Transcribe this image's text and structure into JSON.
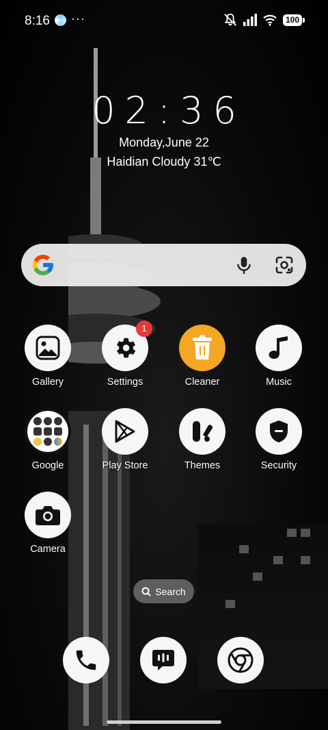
{
  "status_bar": {
    "time": "8:16",
    "more": "···",
    "battery": "100"
  },
  "widget": {
    "clock": "02:36",
    "date": "Monday,June 22",
    "weather": "Haidian Cloudy 31℃"
  },
  "apps": [
    {
      "label": "Gallery",
      "icon": "gallery-icon"
    },
    {
      "label": "Settings",
      "icon": "gear-icon",
      "badge": "1"
    },
    {
      "label": "Cleaner",
      "icon": "trash-icon"
    },
    {
      "label": "Music",
      "icon": "music-note-icon"
    },
    {
      "label": "Google",
      "icon": "google-folder-icon"
    },
    {
      "label": "Play Store",
      "icon": "play-store-icon"
    },
    {
      "label": "Themes",
      "icon": "themes-icon"
    },
    {
      "label": "Security",
      "icon": "shield-icon"
    },
    {
      "label": "Camera",
      "icon": "camera-icon"
    }
  ],
  "search_pill": {
    "label": "Search"
  },
  "dock": [
    {
      "icon": "phone-icon"
    },
    {
      "icon": "messages-icon"
    },
    {
      "icon": "chrome-icon"
    }
  ],
  "colors": {
    "badge": "#e53935",
    "cleaner_accent": "#f5a623",
    "icon_background": "#f6f6f6"
  }
}
